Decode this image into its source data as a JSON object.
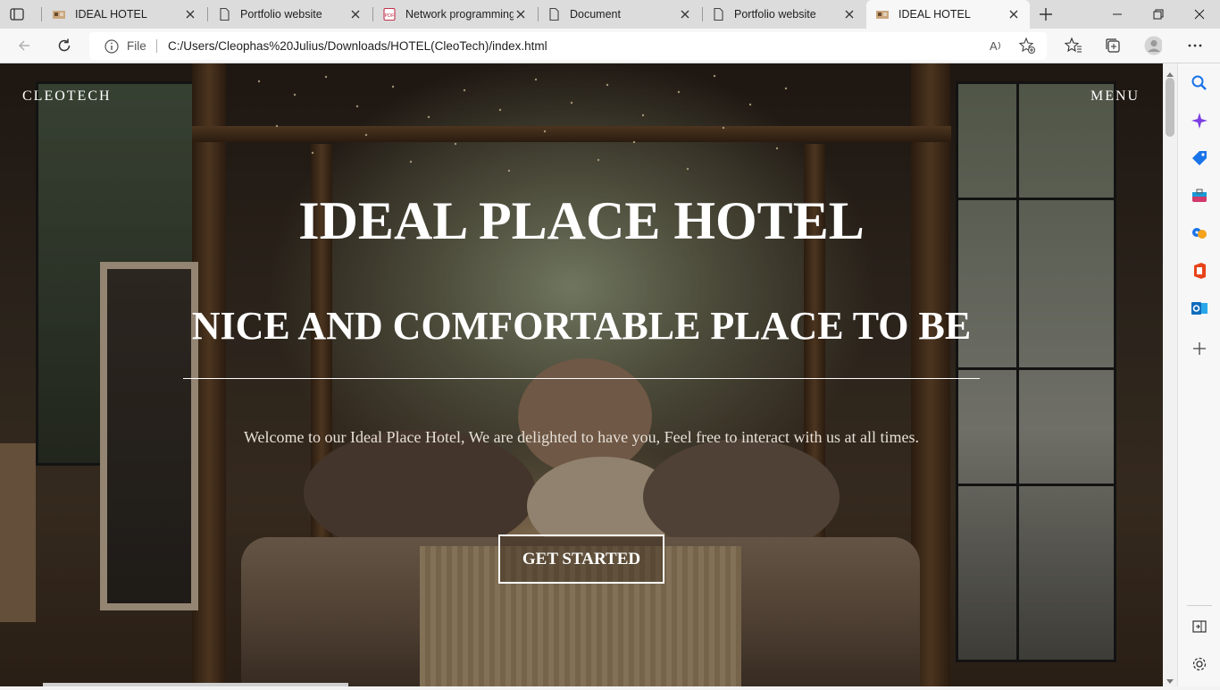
{
  "browser": {
    "tabs": [
      {
        "title": "IDEAL HOTEL",
        "favicon": "hotel-favicon",
        "active": false
      },
      {
        "title": "Portfolio website",
        "favicon": "page-icon",
        "active": false
      },
      {
        "title": "Network programming",
        "favicon": "pdf-icon",
        "active": false
      },
      {
        "title": "Document",
        "favicon": "page-icon",
        "active": false
      },
      {
        "title": "Portfolio website",
        "favicon": "page-icon",
        "active": false
      },
      {
        "title": "IDEAL HOTEL",
        "favicon": "hotel-favicon",
        "active": true
      }
    ],
    "address": {
      "scheme_label": "File",
      "url": "C:/Users/Cleophas%20Julius/Downloads/HOTEL(CleoTech)/index.html"
    },
    "accent_color": "#1a73e8"
  },
  "page": {
    "brand": "CLEOTECH",
    "menu_label": "MENU",
    "hero": {
      "title": "IDEAL PLACE HOTEL",
      "subtitle": "NICE AND COMFORTABLE PLACE TO BE",
      "welcome": "Welcome to our Ideal Place Hotel, We are delighted to have you, Feel free to interact with us at all times.",
      "cta_label": "GET STARTED"
    }
  },
  "sidebar_icons": [
    "search-icon",
    "copilot-icon",
    "shopping-tag-icon",
    "tools-icon",
    "games-icon",
    "office-icon",
    "outlook-icon",
    "add-icon",
    "split-screen-icon",
    "settings-icon"
  ]
}
